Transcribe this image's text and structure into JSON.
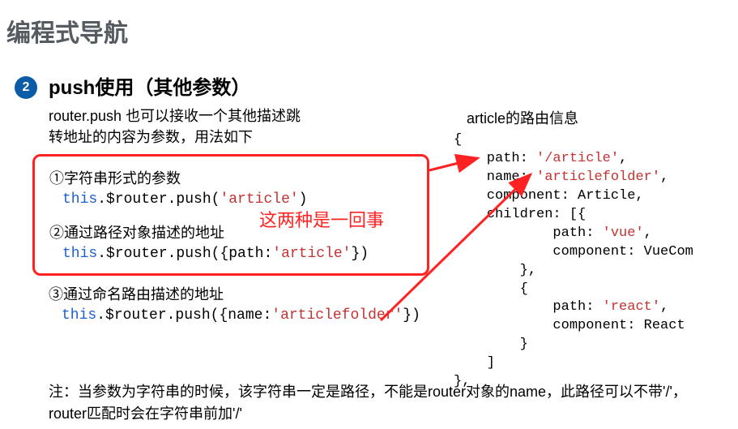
{
  "page_title": "编程式导航",
  "bullet_num": "2",
  "section_title": "push使用（其他参数）",
  "intro_line1": "router.push 也可以接收一个其他描述跳",
  "intro_line2": "转地址的内容为参数，用法如下",
  "ex1_label": "①字符串形式的参数",
  "ex1_code_pre": "this",
  "ex1_code_mid": ".$router.push(",
  "ex1_code_str": "'article'",
  "ex1_code_post": ")",
  "ex2_label": "②通过路径对象描述的地址",
  "ex2_code_pre": "this",
  "ex2_code_mid": ".$router.push({path:",
  "ex2_code_str": "'article'",
  "ex2_code_post": "})",
  "ex3_label": "③通过命名路由描述的地址",
  "ex3_code_pre": "this",
  "ex3_code_mid": ".$router.push({name:",
  "ex3_code_str": "'articlefolder'",
  "ex3_code_post": "})",
  "annotation": "这两种是一回事",
  "right_title": "article的路由信息",
  "rc_l0": "{",
  "rc_l1a": "    path: ",
  "rc_l1s": "'/article'",
  "rc_l1b": ",",
  "rc_l2a": "    name: ",
  "rc_l2s": "'articlefolder'",
  "rc_l2b": ",",
  "rc_l3": "    component: Article,",
  "rc_l4": "    children: [{",
  "rc_l5a": "            path: ",
  "rc_l5s": "'vue'",
  "rc_l5b": ",",
  "rc_l6": "            component: VueCom",
  "rc_l7": "        },",
  "rc_l8": "        {",
  "rc_l9a": "            path: ",
  "rc_l9s": "'react'",
  "rc_l9b": ",",
  "rc_l10": "            component: React",
  "rc_l11": "        }",
  "rc_l12": "    ]",
  "rc_l13": "},",
  "note": "注：当参数为字符串的时候，该字符串一定是路径，不能是router对象的name，此路径可以不带'/'，router匹配时会在字符串前加'/'"
}
